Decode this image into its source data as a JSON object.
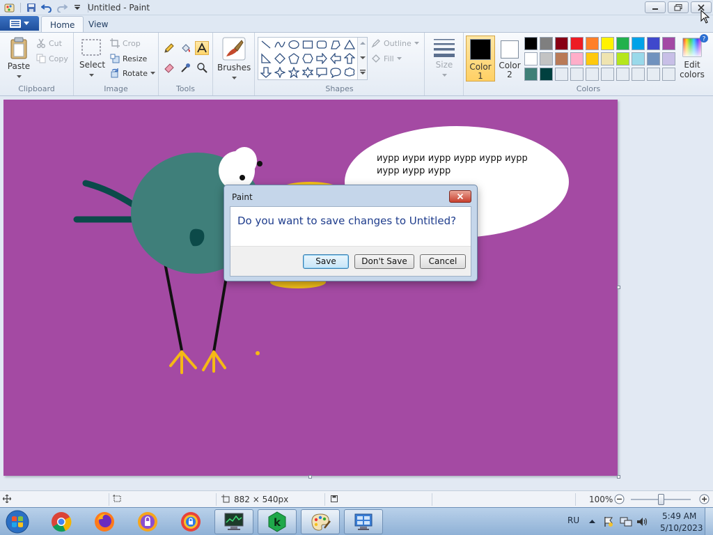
{
  "window": {
    "title": "Untitled - Paint"
  },
  "ribbon": {
    "tabs": [
      {
        "label": "Home",
        "active": true
      },
      {
        "label": "View",
        "active": false
      }
    ],
    "clipboard": {
      "label": "Clipboard",
      "paste": "Paste",
      "cut": "Cut",
      "copy": "Copy"
    },
    "image": {
      "label": "Image",
      "select": "Select",
      "crop": "Crop",
      "resize": "Resize",
      "rotate": "Rotate"
    },
    "tools": {
      "label": "Tools"
    },
    "brushes": {
      "label": "Brushes"
    },
    "shapes": {
      "label": "Shapes",
      "outline": "Outline",
      "fill": "Fill"
    },
    "size": {
      "label": "Size"
    },
    "colors": {
      "label": "Colors",
      "color1_label_line1": "Color",
      "color1_label_line2": "1",
      "color2_label_line1": "Color",
      "color2_label_line2": "2",
      "edit_line1": "Edit",
      "edit_line2": "colors",
      "color1": "#000000",
      "color2": "#ffffff",
      "palette_row1": [
        "#000000",
        "#7f7f7f",
        "#880015",
        "#ed1c24",
        "#ff7f27",
        "#fff200",
        "#22b14c",
        "#00a2e8",
        "#3f48cc",
        "#a349a4"
      ],
      "palette_row2": [
        "#ffffff",
        "#c3c3c3",
        "#b97a57",
        "#ffaec9",
        "#ffc90e",
        "#efe4b0",
        "#b5e61d",
        "#99d9ea",
        "#7092be",
        "#c8bfe7"
      ],
      "palette_row3": [
        "#3f7f77",
        "#00403f",
        "#e6ecf3",
        "#e6ecf3",
        "#e6ecf3",
        "#e6ecf3",
        "#e6ecf3",
        "#e6ecf3",
        "#e6ecf3",
        "#e6ecf3"
      ]
    }
  },
  "canvas": {
    "background": "#a44aa3",
    "bubble_text": "иурр иури иурр иурр иурр иурр иурр иурр иурр"
  },
  "dialog": {
    "title": "Paint",
    "message": "Do you want to save changes to Untitled?",
    "buttons": {
      "save": "Save",
      "dont_save": "Don't Save",
      "cancel": "Cancel"
    }
  },
  "status": {
    "dimensions": "882 × 540px",
    "zoom": "100%"
  },
  "taskbar": {
    "language": "RU",
    "time": "5:49 AM",
    "date": "5/10/2023"
  }
}
